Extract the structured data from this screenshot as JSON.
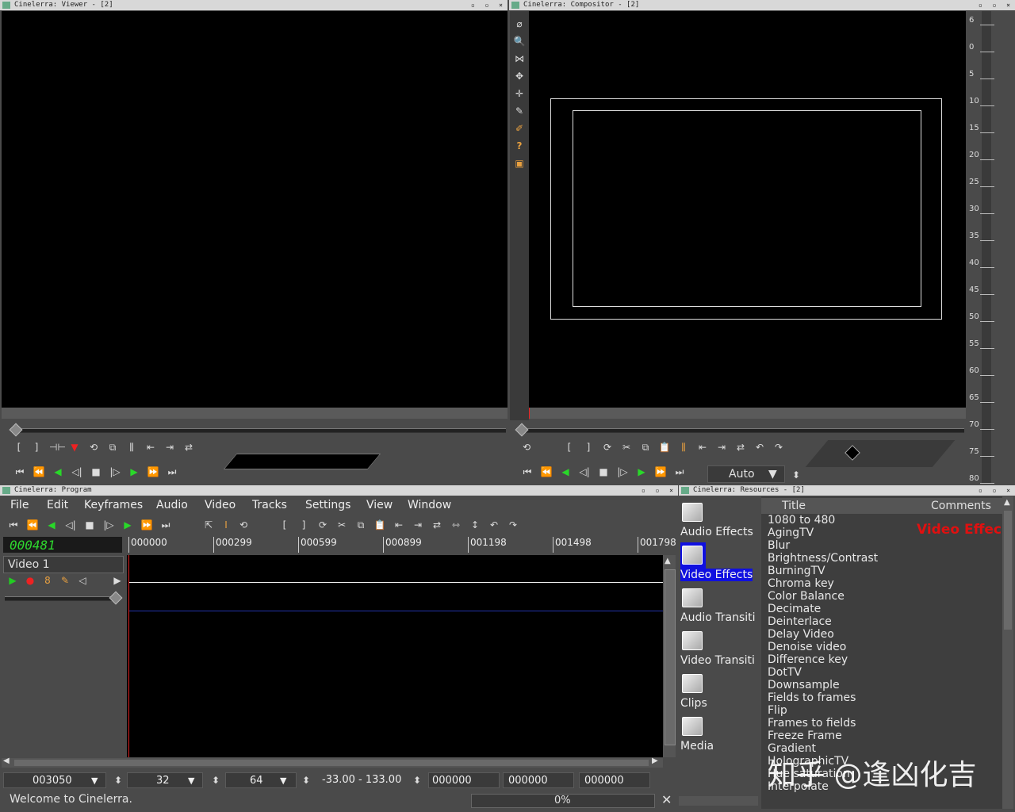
{
  "viewer": {
    "title": "Cinelerra: Viewer - [2]",
    "title_controls": "▫ ▫ ×"
  },
  "compositor": {
    "title": "Cinelerra: Compositor - [2]",
    "title_controls": "▫ ▫ ×",
    "zoom_value": "Auto",
    "ruler_labels": [
      "6",
      "0",
      "5",
      "10",
      "15",
      "20",
      "25",
      "30",
      "35",
      "40",
      "45",
      "50",
      "55",
      "60",
      "65",
      "70",
      "75",
      "80"
    ]
  },
  "program": {
    "title": "Cinelerra: Program",
    "title_controls": "▫ ▫ ×",
    "menu": [
      "File",
      "Edit",
      "Keyframes",
      "Audio",
      "Video",
      "Tracks",
      "Settings",
      "View",
      "Window"
    ],
    "timecode": "000481",
    "timeline_marks": [
      "000000",
      "000299",
      "000599",
      "000899",
      "001198",
      "001498",
      "001798"
    ],
    "track_name": "Video 1",
    "bottom_fields": {
      "position": "003050",
      "zoom1": "32",
      "zoom2": "64",
      "range": "-33.00 - 133.00",
      "in_point": "000000",
      "length": "000000",
      "out_point": "000000"
    },
    "status": "Welcome to Cinelerra.",
    "progress": "0%"
  },
  "resources": {
    "title": "Cinelerra: Resources - [2]",
    "title_controls": "▫ ▫ ×",
    "folders": [
      "Audio Effects",
      "Video Effects",
      "Audio Transiti",
      "Video Transiti",
      "Clips",
      "Media"
    ],
    "selected_folder": "Video Effects",
    "col_title": "Title",
    "col_comments": "Comments",
    "header_label": "Video Effec",
    "items": [
      "1080 to 480",
      "AgingTV",
      "Blur",
      "Brightness/Contrast",
      "BurningTV",
      "Chroma key",
      "Color Balance",
      "Decimate",
      "Deinterlace",
      "Delay Video",
      "Denoise video",
      "Difference key",
      "DotTV",
      "Downsample",
      "Fields to frames",
      "Flip",
      "Frames to fields",
      "Freeze Frame",
      "Gradient",
      "HolographicTV",
      "Hue saturation",
      "Interpolate"
    ]
  },
  "watermark": "知乎 @逢凶化吉",
  "colors": {
    "timecode_green": "#2ed82e",
    "play_green": "#29d829",
    "selection_blue": "#1010e0",
    "header_red": "#e01010"
  }
}
